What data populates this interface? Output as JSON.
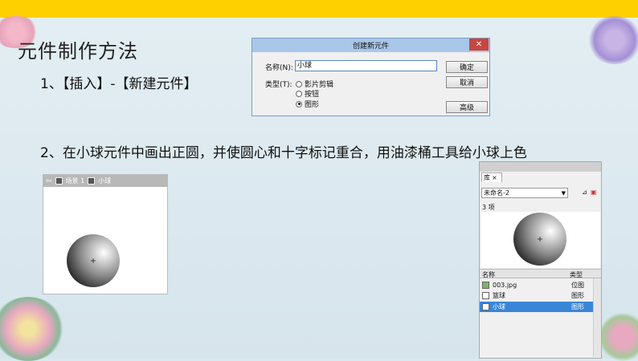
{
  "heading": "元件制作方法",
  "step1": "1、【插入】-【新建元件】",
  "step2": "2、在小球元件中画出正圆，并使圆心和十字标记重合，用油漆桶工具给小球上色",
  "dialog": {
    "title": "创建新元件",
    "close": "✕",
    "name_label": "名称(N):",
    "name_value": "小球",
    "type_label": "类型(T):",
    "types": [
      "影片剪辑",
      "按钮",
      "图形"
    ],
    "selected_type": "图形",
    "ok": "确定",
    "cancel": "取消",
    "advanced": "高级"
  },
  "stage": {
    "scene": "场景 1",
    "symbol": "小球",
    "back_icon": "arrow-left-icon"
  },
  "library": {
    "tab": "库",
    "tab_close": "×",
    "document": "未命名-2",
    "count": "3 项",
    "col_name": "名称",
    "col_type": "类型",
    "items": [
      {
        "name": "003.jpg",
        "type": "位图"
      },
      {
        "name": "篮球",
        "type": "图形"
      },
      {
        "name": "小球",
        "type": "图形"
      }
    ],
    "selected": "小球"
  },
  "colors": {
    "topbar": "#ffd000",
    "selection": "#3a86d6",
    "dialog_title": "#a9c7e8"
  }
}
